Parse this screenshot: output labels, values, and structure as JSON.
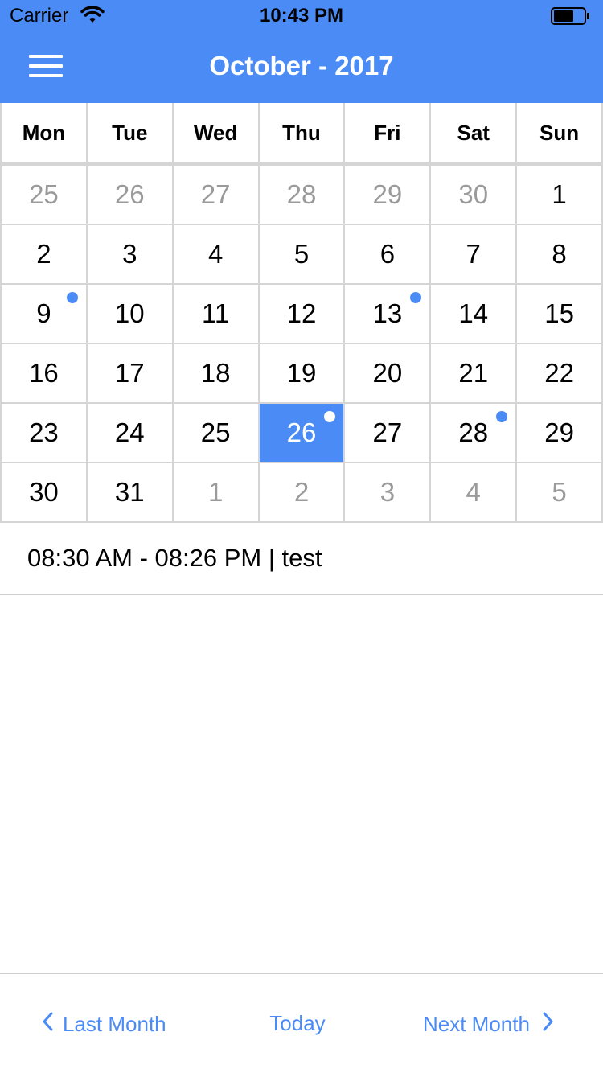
{
  "status_bar": {
    "carrier": "Carrier",
    "time": "10:43 PM"
  },
  "header": {
    "title": "October - 2017"
  },
  "weekdays": [
    "Mon",
    "Tue",
    "Wed",
    "Thu",
    "Fri",
    "Sat",
    "Sun"
  ],
  "weeks": [
    [
      {
        "day": "25",
        "muted": true
      },
      {
        "day": "26",
        "muted": true
      },
      {
        "day": "27",
        "muted": true
      },
      {
        "day": "28",
        "muted": true
      },
      {
        "day": "29",
        "muted": true
      },
      {
        "day": "30",
        "muted": true
      },
      {
        "day": "1"
      }
    ],
    [
      {
        "day": "2"
      },
      {
        "day": "3"
      },
      {
        "day": "4"
      },
      {
        "day": "5"
      },
      {
        "day": "6"
      },
      {
        "day": "7"
      },
      {
        "day": "8"
      }
    ],
    [
      {
        "day": "9",
        "event": true
      },
      {
        "day": "10"
      },
      {
        "day": "11"
      },
      {
        "day": "12"
      },
      {
        "day": "13",
        "event": true
      },
      {
        "day": "14"
      },
      {
        "day": "15"
      }
    ],
    [
      {
        "day": "16"
      },
      {
        "day": "17"
      },
      {
        "day": "18"
      },
      {
        "day": "19"
      },
      {
        "day": "20"
      },
      {
        "day": "21"
      },
      {
        "day": "22"
      }
    ],
    [
      {
        "day": "23"
      },
      {
        "day": "24"
      },
      {
        "day": "25"
      },
      {
        "day": "26",
        "selected": true,
        "event": true
      },
      {
        "day": "27"
      },
      {
        "day": "28",
        "event": true
      },
      {
        "day": "29"
      }
    ],
    [
      {
        "day": "30"
      },
      {
        "day": "31"
      },
      {
        "day": "1",
        "muted": true
      },
      {
        "day": "2",
        "muted": true
      },
      {
        "day": "3",
        "muted": true
      },
      {
        "day": "4",
        "muted": true
      },
      {
        "day": "5",
        "muted": true
      }
    ]
  ],
  "event": {
    "text": "08:30 AM - 08:26 PM | test"
  },
  "bottom_nav": {
    "last_month": "Last Month",
    "today": "Today",
    "next_month": "Next Month"
  },
  "colors": {
    "accent": "#4a8bf5",
    "muted_text": "#9a9a9a",
    "grid_line": "#d5d5d5"
  },
  "icons": {
    "menu": "hamburger-icon",
    "prev": "chevron-left-icon",
    "next": "chevron-right-icon",
    "wifi": "wifi-icon",
    "battery": "battery-icon"
  }
}
